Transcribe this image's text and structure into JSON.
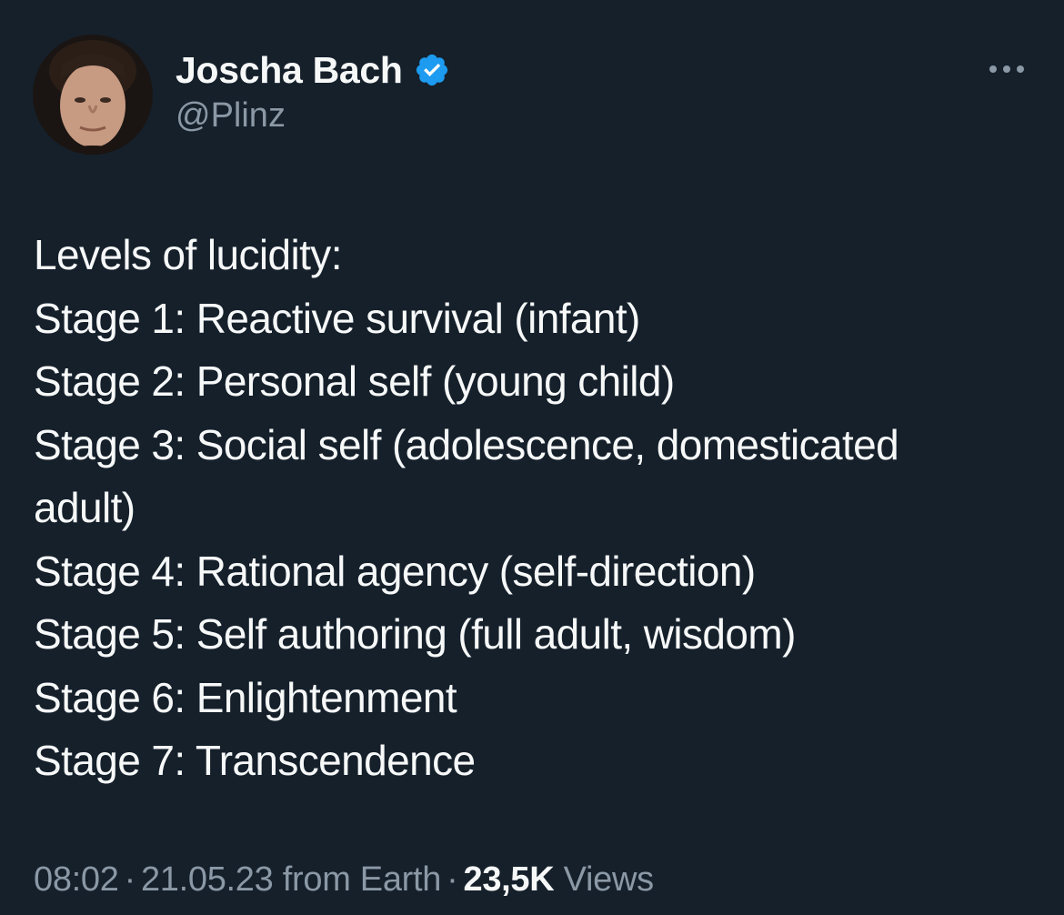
{
  "author": {
    "display_name": "Joscha Bach",
    "handle": "@Plinz",
    "verified": true,
    "avatar_icon": "profile-photo"
  },
  "menu": {
    "icon": "more-horizontal-icon"
  },
  "tweet": {
    "lines": [
      "Levels of lucidity:",
      "Stage 1: Reactive survival (infant)",
      "Stage 2: Personal self (young child)",
      "Stage 3: Social self (adolescence, domesticated",
      "adult)",
      "Stage 4: Rational agency (self-direction)",
      "Stage 5: Self authoring (full adult, wisdom)",
      "Stage 6: Enlightenment",
      "Stage 7: Transcendence"
    ]
  },
  "meta": {
    "time": "08:02",
    "date": "21.05.23",
    "source": "from Earth",
    "separator": "·",
    "views_count": "23,5K",
    "views_label": "Views"
  },
  "colors": {
    "background": "#15202b",
    "text_primary": "#f7f9f9",
    "text_secondary": "#8b98a5",
    "verified_badge": "#1d9bf0"
  }
}
